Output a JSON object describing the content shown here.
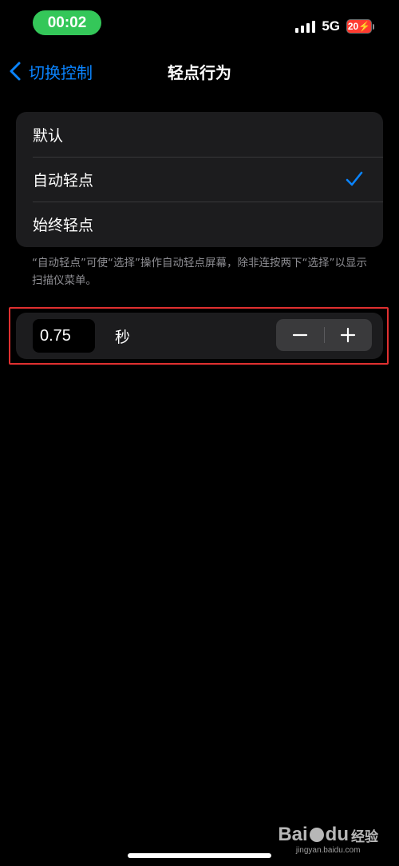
{
  "status_bar": {
    "time": "00:02",
    "network": "5G",
    "battery": "20"
  },
  "nav": {
    "back_label": "切换控制",
    "title": "轻点行为"
  },
  "options": [
    {
      "label": "默认",
      "selected": false
    },
    {
      "label": "自动轻点",
      "selected": true
    },
    {
      "label": "始终轻点",
      "selected": false
    }
  ],
  "footnote": "“自动轻点”可使“选择”操作自动轻点屏幕，除非连按两下“选择”以显示扫描仪菜单。",
  "delay": {
    "value": "0.75",
    "unit": "秒"
  },
  "icons": {
    "back": "chevron-left-icon",
    "check": "checkmark-icon",
    "minus": "minus-icon",
    "plus": "plus-icon"
  },
  "colors": {
    "accent": "#0a84ff",
    "time_pill": "#34c759",
    "battery_low": "#ff3b30",
    "card": "#1c1c1e",
    "highlight": "#e03030"
  },
  "watermark": {
    "brand": "Bai du 经验",
    "url": "jingyan.baidu.com"
  }
}
